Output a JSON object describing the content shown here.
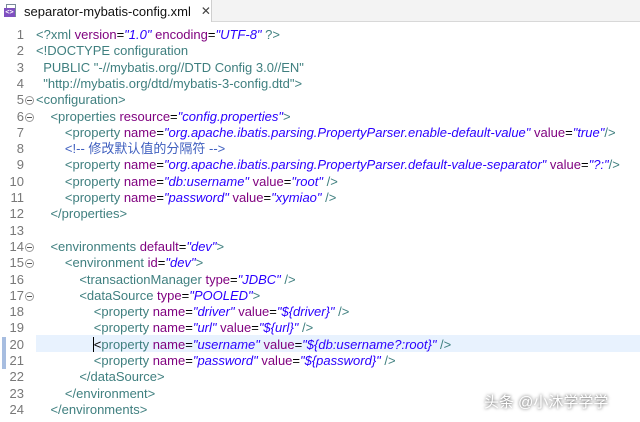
{
  "tab": {
    "title": "separator-mybatis-config.xml",
    "close_glyph": "✕",
    "icon_glyph": "<>"
  },
  "watermark": {
    "text": "头条 @小沐学学学"
  },
  "lines": [
    {
      "n": "1",
      "fold": false,
      "changed": false,
      "tokens": [
        [
          "tag",
          "<?xml "
        ],
        [
          "attr",
          "version"
        ],
        [
          "text",
          "="
        ],
        [
          "val",
          "\"1.0\""
        ],
        [
          "text",
          " "
        ],
        [
          "attr",
          "encoding"
        ],
        [
          "text",
          "="
        ],
        [
          "val",
          "\"UTF-8\""
        ],
        [
          "tag",
          " ?>"
        ]
      ]
    },
    {
      "n": "2",
      "fold": false,
      "changed": false,
      "tokens": [
        [
          "tag",
          "<!DOCTYPE configuration"
        ]
      ]
    },
    {
      "n": "3",
      "fold": false,
      "changed": false,
      "tokens": [
        [
          "tag",
          "  PUBLIC \"-//mybatis.org//DTD Config 3.0//EN\""
        ]
      ]
    },
    {
      "n": "4",
      "fold": false,
      "changed": false,
      "tokens": [
        [
          "tag",
          "  \"http://mybatis.org/dtd/mybatis-3-config.dtd\">"
        ]
      ]
    },
    {
      "n": "5",
      "fold": true,
      "changed": false,
      "tokens": [
        [
          "tag",
          "<configuration>"
        ]
      ]
    },
    {
      "n": "6",
      "fold": true,
      "changed": false,
      "tokens": [
        [
          "text",
          "    "
        ],
        [
          "tag",
          "<properties "
        ],
        [
          "attr",
          "resource"
        ],
        [
          "text",
          "="
        ],
        [
          "val",
          "\"config.properties\""
        ],
        [
          "tag",
          ">"
        ]
      ]
    },
    {
      "n": "7",
      "fold": false,
      "changed": false,
      "tokens": [
        [
          "text",
          "        "
        ],
        [
          "tag",
          "<property "
        ],
        [
          "attr",
          "name"
        ],
        [
          "text",
          "="
        ],
        [
          "val",
          "\"org.apache.ibatis.parsing.PropertyParser.enable-default-value\""
        ],
        [
          "text",
          " "
        ],
        [
          "attr",
          "value"
        ],
        [
          "text",
          "="
        ],
        [
          "val",
          "\"true\""
        ],
        [
          "tag",
          "/>"
        ]
      ]
    },
    {
      "n": "8",
      "fold": false,
      "changed": false,
      "tokens": [
        [
          "text",
          "        "
        ],
        [
          "com",
          "<!-- 修改默认值的分隔符 -->"
        ]
      ]
    },
    {
      "n": "9",
      "fold": false,
      "changed": false,
      "tokens": [
        [
          "text",
          "        "
        ],
        [
          "tag",
          "<property "
        ],
        [
          "attr",
          "name"
        ],
        [
          "text",
          "="
        ],
        [
          "val",
          "\"org.apache.ibatis.parsing.PropertyParser.default-value-separator\""
        ],
        [
          "text",
          " "
        ],
        [
          "attr",
          "value"
        ],
        [
          "text",
          "="
        ],
        [
          "val",
          "\"?:\""
        ],
        [
          "tag",
          "/>"
        ]
      ]
    },
    {
      "n": "10",
      "fold": false,
      "changed": false,
      "tokens": [
        [
          "text",
          "        "
        ],
        [
          "tag",
          "<property "
        ],
        [
          "attr",
          "name"
        ],
        [
          "text",
          "="
        ],
        [
          "val",
          "\"db:username\""
        ],
        [
          "text",
          " "
        ],
        [
          "attr",
          "value"
        ],
        [
          "text",
          "="
        ],
        [
          "val",
          "\"root\""
        ],
        [
          "tag",
          " />"
        ]
      ]
    },
    {
      "n": "11",
      "fold": false,
      "changed": false,
      "tokens": [
        [
          "text",
          "        "
        ],
        [
          "tag",
          "<property "
        ],
        [
          "attr",
          "name"
        ],
        [
          "text",
          "="
        ],
        [
          "val",
          "\"password\""
        ],
        [
          "text",
          " "
        ],
        [
          "attr",
          "value"
        ],
        [
          "text",
          "="
        ],
        [
          "val",
          "\"xymiao\""
        ],
        [
          "tag",
          " />"
        ]
      ]
    },
    {
      "n": "12",
      "fold": false,
      "changed": false,
      "tokens": [
        [
          "text",
          "    "
        ],
        [
          "tag",
          "</properties>"
        ]
      ]
    },
    {
      "n": "13",
      "fold": false,
      "changed": false,
      "tokens": []
    },
    {
      "n": "14",
      "fold": true,
      "changed": false,
      "tokens": [
        [
          "text",
          "    "
        ],
        [
          "tag",
          "<environments "
        ],
        [
          "attr",
          "default"
        ],
        [
          "text",
          "="
        ],
        [
          "val",
          "\"dev\""
        ],
        [
          "tag",
          ">"
        ]
      ]
    },
    {
      "n": "15",
      "fold": true,
      "changed": false,
      "tokens": [
        [
          "text",
          "        "
        ],
        [
          "tag",
          "<environment "
        ],
        [
          "attr",
          "id"
        ],
        [
          "text",
          "="
        ],
        [
          "val",
          "\"dev\""
        ],
        [
          "tag",
          ">"
        ]
      ]
    },
    {
      "n": "16",
      "fold": false,
      "changed": false,
      "tokens": [
        [
          "text",
          "            "
        ],
        [
          "tag",
          "<transactionManager "
        ],
        [
          "attr",
          "type"
        ],
        [
          "text",
          "="
        ],
        [
          "val",
          "\"JDBC\""
        ],
        [
          "tag",
          " />"
        ]
      ]
    },
    {
      "n": "17",
      "fold": true,
      "changed": false,
      "tokens": [
        [
          "text",
          "            "
        ],
        [
          "tag",
          "<dataSource "
        ],
        [
          "attr",
          "type"
        ],
        [
          "text",
          "="
        ],
        [
          "val",
          "\"POOLED\""
        ],
        [
          "tag",
          ">"
        ]
      ]
    },
    {
      "n": "18",
      "fold": false,
      "changed": false,
      "tokens": [
        [
          "text",
          "                "
        ],
        [
          "tag",
          "<property "
        ],
        [
          "attr",
          "name"
        ],
        [
          "text",
          "="
        ],
        [
          "val",
          "\"driver\""
        ],
        [
          "text",
          " "
        ],
        [
          "attr",
          "value"
        ],
        [
          "text",
          "="
        ],
        [
          "val",
          "\"${driver}\""
        ],
        [
          "tag",
          " />"
        ]
      ]
    },
    {
      "n": "19",
      "fold": false,
      "changed": false,
      "tokens": [
        [
          "text",
          "                "
        ],
        [
          "tag",
          "<property "
        ],
        [
          "attr",
          "name"
        ],
        [
          "text",
          "="
        ],
        [
          "val",
          "\"url\""
        ],
        [
          "text",
          " "
        ],
        [
          "attr",
          "value"
        ],
        [
          "text",
          "="
        ],
        [
          "val",
          "\"${url}\""
        ],
        [
          "tag",
          " />"
        ]
      ]
    },
    {
      "n": "20",
      "fold": false,
      "changed": true,
      "tokens": [
        [
          "text",
          "                "
        ],
        [
          "cursor",
          "<"
        ],
        [
          "tag",
          "property "
        ],
        [
          "attr",
          "name"
        ],
        [
          "text",
          "="
        ],
        [
          "val",
          "\"username\""
        ],
        [
          "text",
          " "
        ],
        [
          "attr",
          "value"
        ],
        [
          "text",
          "="
        ],
        [
          "val",
          "\"${db:username?:root}\""
        ],
        [
          "tag",
          " />"
        ]
      ]
    },
    {
      "n": "21",
      "fold": false,
      "changed": true,
      "tokens": [
        [
          "text",
          "                "
        ],
        [
          "tag",
          "<property "
        ],
        [
          "attr",
          "name"
        ],
        [
          "text",
          "="
        ],
        [
          "val",
          "\"password\""
        ],
        [
          "text",
          " "
        ],
        [
          "attr",
          "value"
        ],
        [
          "text",
          "="
        ],
        [
          "val",
          "\"${password}\""
        ],
        [
          "tag",
          " />"
        ]
      ]
    },
    {
      "n": "22",
      "fold": false,
      "changed": false,
      "tokens": [
        [
          "text",
          "            "
        ],
        [
          "tag",
          "</dataSource>"
        ]
      ]
    },
    {
      "n": "23",
      "fold": false,
      "changed": false,
      "tokens": [
        [
          "text",
          "        "
        ],
        [
          "tag",
          "</environment>"
        ]
      ]
    },
    {
      "n": "24",
      "fold": false,
      "changed": false,
      "tokens": [
        [
          "text",
          "    "
        ],
        [
          "tag",
          "</environments>"
        ]
      ]
    }
  ]
}
